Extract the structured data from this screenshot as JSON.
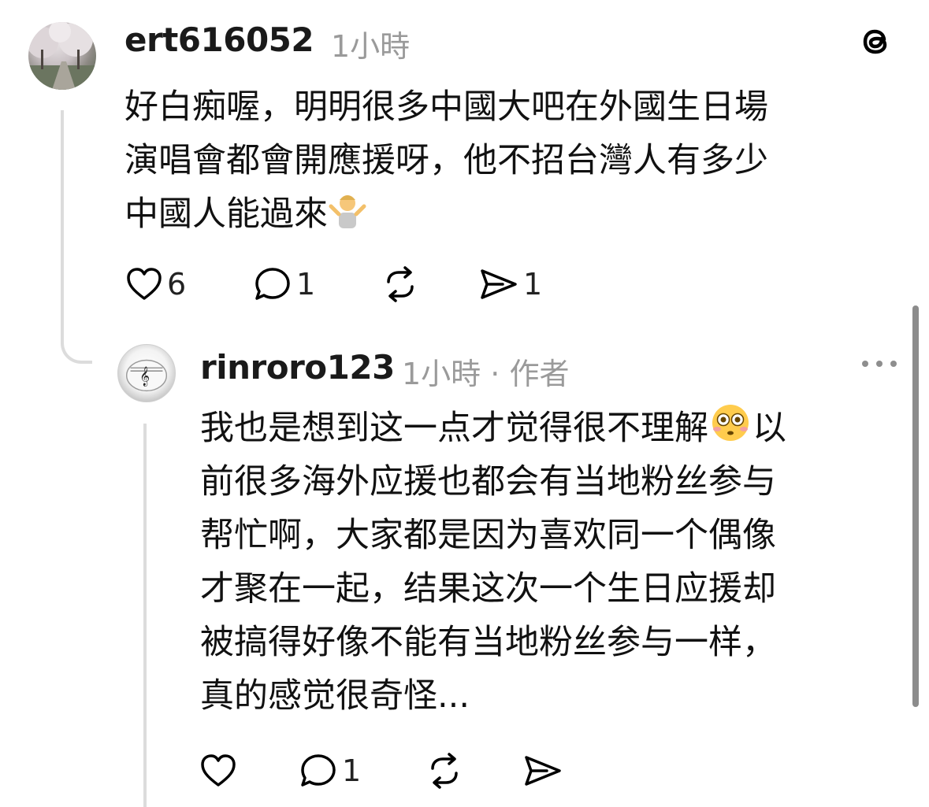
{
  "comment": {
    "username": "ert616052",
    "time": "1小時",
    "lines": [
      "好白痴喔，明明很多中國大吧在外國生日場",
      "演唱會都會開應援呀，他不招台灣人有多少",
      "中國人能過來"
    ],
    "emoji": "person-shrugging-emoji",
    "likes": "6",
    "replies": "1",
    "shares": "1"
  },
  "reply": {
    "username": "rinroro123",
    "time": "1小時",
    "separator": "·",
    "badge": "作者",
    "lines": [
      "我也是想到这一点才觉得很不理解",
      "前很多海外应援也都会有当地粉丝参与",
      "帮忙啊，大家都是因为喜欢同一个偶像",
      "才聚在一起，结果这次一个生日应援却",
      "被搞得好像不能有当地粉丝参与一样，",
      "真的感觉很奇怪..."
    ],
    "line1_suffix": "以",
    "emoji": "flushed-face-emoji",
    "replies": "1"
  },
  "icons": {
    "app_logo": "threads-logo-icon",
    "more": "more-options-icon",
    "like": "heart-icon",
    "reply": "comment-icon",
    "repost": "repost-icon",
    "share": "share-icon"
  }
}
